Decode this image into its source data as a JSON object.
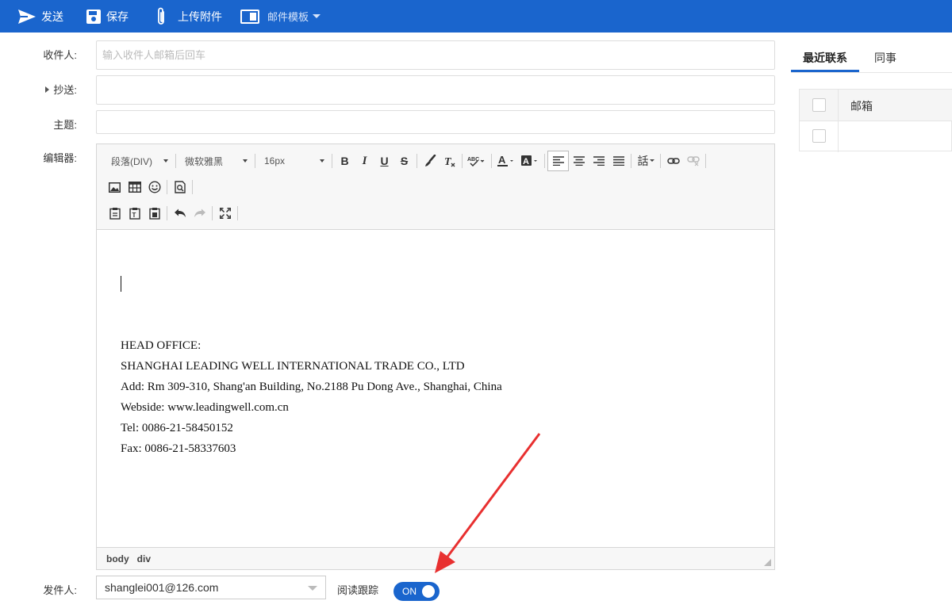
{
  "toolbar": {
    "send_label": "发送",
    "save_label": "保存",
    "attach_label": "上传附件",
    "template_label": "邮件模板"
  },
  "form": {
    "to_label": "收件人:",
    "to_placeholder": "输入收件人邮箱后回车",
    "cc_label": "抄送:",
    "subject_label": "主题:",
    "editor_label": "编辑器:",
    "from_label": "发件人:"
  },
  "editor": {
    "paragraph_format": "段落(DIV)",
    "font_family": "微软雅黑",
    "font_size": "16px",
    "line_height_icon_text": "話",
    "signature": [
      "HEAD OFFICE:",
      "SHANGHAI LEADING WELL INTERNATIONAL TRADE CO., LTD",
      "Add: Rm 309-310, Shang'an Building, No.2188 Pu Dong Ave., Shanghai, China",
      "Webside: www.leadingwell.com.cn",
      "Tel: 0086-21-58450152",
      "Fax: 0086-21-58337603"
    ],
    "status_path": [
      "body",
      "div"
    ]
  },
  "sender": {
    "value": "shanglei001@126.com",
    "read_tracking_label": "阅读跟踪",
    "toggle_label": "ON"
  },
  "contacts": {
    "tabs": [
      "最近联系",
      "同事"
    ],
    "active_tab": 0,
    "column_header": "邮箱"
  },
  "colors": {
    "accent": "#1a65cd",
    "annotation_arrow": "#e83030"
  }
}
